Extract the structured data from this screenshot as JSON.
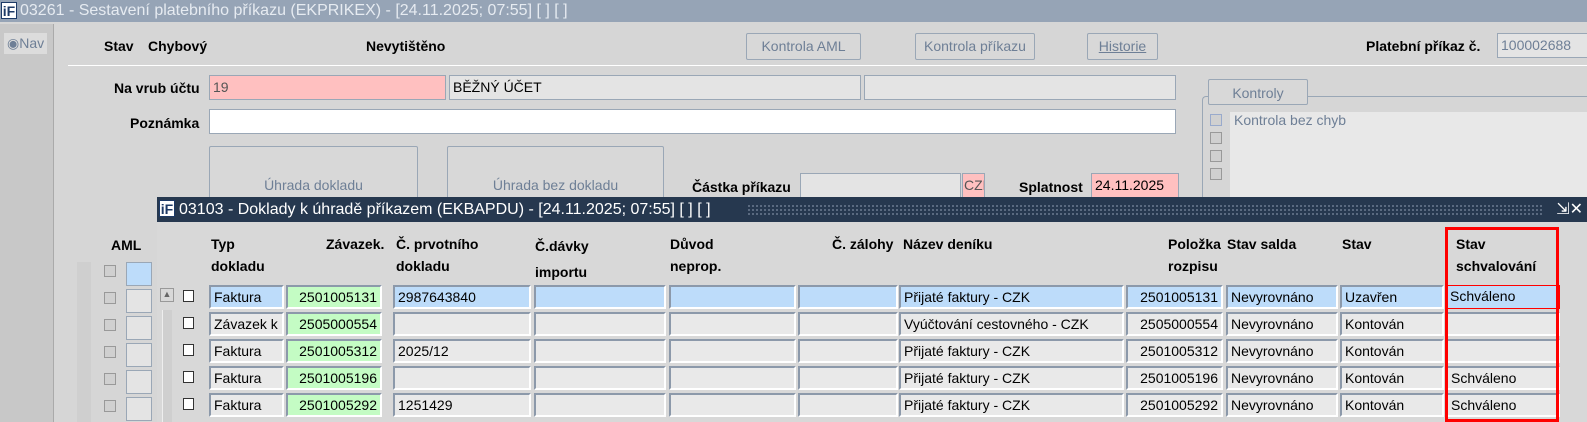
{
  "main_window": {
    "logo": "iF",
    "title": "03261 - Sestavení platebního příkazu (EKPRIKEX) - [24.11.2025; 07:55]  [ ]  [ ]"
  },
  "nav": {
    "label": "Nav"
  },
  "header": {
    "stav_label": "Stav",
    "stav_value": "Chybový",
    "print_status": "Nevytištěno",
    "btn_aml": "Kontrola AML",
    "btn_kontrola": "Kontrola příkazu",
    "btn_historie": "Historie",
    "prikaz_label": "Platební příkaz č.",
    "prikaz_value": "100002688"
  },
  "form": {
    "ucet_label": "Na vrub účtu",
    "ucet_value": "19",
    "ucet_name": "BĚŽNÝ ÚČET",
    "ucet_extra": "",
    "poznamka_label": "Poznámka",
    "poznamka_value": "",
    "btn_uhrada": "Úhrada dokladu",
    "btn_uhrada_bez": "Úhrada bez dokladu",
    "castka_label": "Částka příkazu",
    "castka_value": "",
    "mena": "CZK",
    "splatnost_label": "Splatnost",
    "splatnost_value": "24.11.2025",
    "aml_label": "AML"
  },
  "kontroly": {
    "tab": "Kontroly",
    "items": [
      "Kontrola bez chyb",
      "",
      "",
      ""
    ]
  },
  "inner_window": {
    "logo": "iF",
    "title": "03103 - Doklady k úhradě příkazem (EKBAPDU) - [24.11.2025; 07:55]  [ ]  [ ]"
  },
  "table": {
    "headers": [
      "Typ\ndokladu",
      "Závazek.",
      "Č. prvotního\ndokladu",
      "Č.dávky\nimportu",
      "Důvod\nneprop.",
      "Č. zálohy",
      "Název deníku",
      "Položka\nrozpisu",
      "Stav salda",
      "Stav",
      "Stav\nschvalování"
    ],
    "rows": [
      [
        "Faktura",
        "2501005131",
        "2987643840",
        "",
        "",
        "",
        "Přijaté faktury - CZK",
        "2501005131",
        "Nevyrovnáno",
        "Uzavřen",
        "Schváleno"
      ],
      [
        "Závazek k zúčtování",
        "2505000554",
        "",
        "",
        "",
        "",
        "Vyúčtování cestovného - CZK",
        "2505000554",
        "Nevyrovnáno",
        "Kontován",
        ""
      ],
      [
        "Faktura",
        "2501005312",
        "2025/12",
        "",
        "",
        "",
        "Přijaté faktury - CZK",
        "2501005312",
        "Nevyrovnáno",
        "Kontován",
        ""
      ],
      [
        "Faktura",
        "2501005196",
        "",
        "",
        "",
        "",
        "Přijaté faktury - CZK",
        "2501005196",
        "Nevyrovnáno",
        "Kontován",
        "Schváleno"
      ],
      [
        "Faktura",
        "2501005292",
        "1251429",
        "",
        "",
        "",
        "Přijaté faktury - CZK",
        "2501005292",
        "Nevyrovnáno",
        "Kontován",
        "Schváleno"
      ]
    ]
  }
}
